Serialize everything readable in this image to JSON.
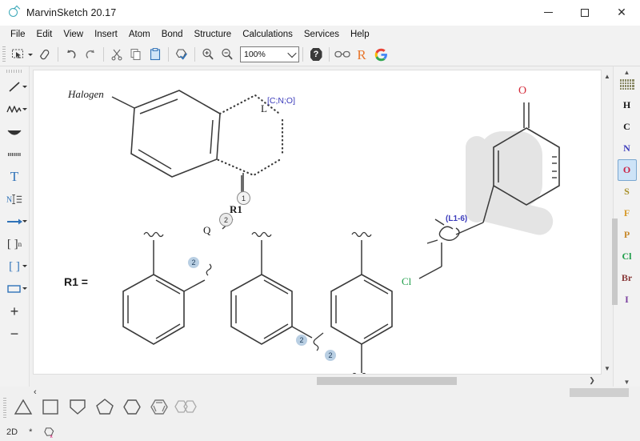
{
  "window": {
    "title": "MarvinSketch 20.17",
    "app_icon": "flask-icon",
    "minimize_label": "Minimize",
    "maximize_label": "Maximize",
    "close_label": "Close"
  },
  "menu": {
    "items": [
      {
        "label": "File"
      },
      {
        "label": "Edit"
      },
      {
        "label": "View"
      },
      {
        "label": "Insert"
      },
      {
        "label": "Atom"
      },
      {
        "label": "Bond"
      },
      {
        "label": "Structure"
      },
      {
        "label": "Calculations"
      },
      {
        "label": "Services"
      },
      {
        "label": "Help"
      }
    ]
  },
  "toolbar": {
    "buttons": [
      {
        "name": "rectangle-select-icon",
        "tooltip": "Selection"
      },
      {
        "name": "eraser-icon",
        "tooltip": "Eraser"
      },
      {
        "name": "undo-icon",
        "tooltip": "Undo"
      },
      {
        "name": "redo-icon",
        "tooltip": "Redo"
      },
      {
        "name": "cut-icon",
        "tooltip": "Cut"
      },
      {
        "name": "copy-icon",
        "tooltip": "Copy"
      },
      {
        "name": "paste-icon",
        "tooltip": "Paste"
      },
      {
        "name": "structure-checker-icon",
        "tooltip": "Structure Checker"
      },
      {
        "name": "zoom-in-icon",
        "tooltip": "Zoom In"
      },
      {
        "name": "zoom-out-icon",
        "tooltip": "Zoom Out"
      },
      {
        "name": "help-icon",
        "tooltip": "Help"
      },
      {
        "name": "glasses-icon",
        "tooltip": "View"
      },
      {
        "name": "reaxys-icon",
        "tooltip": "Reaxys"
      },
      {
        "name": "google-icon",
        "tooltip": "Google"
      }
    ],
    "zoom": {
      "value": "100%",
      "label": "Zoom level"
    },
    "reaxys_letter": "R",
    "google_letter": "G"
  },
  "left_tools": {
    "items": [
      {
        "name": "single-bond-tool",
        "label": "Single bond",
        "has_dropdown": true
      },
      {
        "name": "chain-tool",
        "label": "Chain",
        "has_dropdown": true
      },
      {
        "name": "arc-tool",
        "label": "Arc",
        "has_dropdown": false
      },
      {
        "name": "dotted-bond-tool",
        "label": "Dotted bond",
        "has_dropdown": false
      },
      {
        "name": "text-tool",
        "label": "Text",
        "has_dropdown": false,
        "glyph": "T"
      },
      {
        "name": "atom-label-tool",
        "label": "Atom label",
        "has_dropdown": false,
        "glyph": "N"
      },
      {
        "name": "reaction-arrow-tool",
        "label": "Reaction arrow",
        "has_dropdown": true
      },
      {
        "name": "repeating-unit-tool",
        "label": "Repeating unit",
        "has_dropdown": false,
        "glyph": "[ ]n"
      },
      {
        "name": "bracket-tool",
        "label": "Bracket",
        "has_dropdown": true,
        "glyph": "[ ]"
      },
      {
        "name": "rectangle-tool",
        "label": "Rectangle",
        "has_dropdown": true
      },
      {
        "name": "charge-plus-tool",
        "label": "Increase charge",
        "has_dropdown": false,
        "glyph": "+"
      },
      {
        "name": "charge-minus-tool",
        "label": "Decrease charge",
        "has_dropdown": false,
        "glyph": "−"
      }
    ]
  },
  "right_elements": {
    "periodic_table_label": "Periodic table",
    "scroll_up_label": "Scroll up",
    "scroll_down_label": "Scroll down",
    "selected": "O",
    "items": [
      {
        "symbol": "H",
        "color": "#1a1a1a"
      },
      {
        "symbol": "C",
        "color": "#1a1a1a"
      },
      {
        "symbol": "N",
        "color": "#3b3bbb"
      },
      {
        "symbol": "O",
        "color": "#cc2244"
      },
      {
        "symbol": "S",
        "color": "#a89028"
      },
      {
        "symbol": "F",
        "color": "#d79a2b"
      },
      {
        "symbol": "P",
        "color": "#c88a2c"
      },
      {
        "symbol": "Cl",
        "color": "#1f9e4a"
      },
      {
        "symbol": "Br",
        "color": "#8a3a3a"
      },
      {
        "symbol": "I",
        "color": "#7a3f9e"
      }
    ]
  },
  "bottom_templates": {
    "prev_label": "‹",
    "shapes": [
      {
        "name": "triangle-template",
        "label": "Cyclopropane"
      },
      {
        "name": "square-template",
        "label": "Cyclobutane"
      },
      {
        "name": "home-template",
        "label": "Cyclopentadiene"
      },
      {
        "name": "pentagon-template",
        "label": "Cyclopentane"
      },
      {
        "name": "hexagon-template",
        "label": "Cyclohexane"
      },
      {
        "name": "benzene-template",
        "label": "Benzene"
      },
      {
        "name": "naphthalene-template",
        "label": "Naphthalene"
      }
    ]
  },
  "statusbar": {
    "dimension": "2D",
    "chirality_flag": "*",
    "checker_status": "no-errors"
  },
  "canvas": {
    "structure_left": {
      "halogen_label": "Halogen",
      "linker_label": "L",
      "linker_query": "[C;N;O]",
      "map_1": "1",
      "map_2": "2",
      "r1_label": "R1",
      "q_label": "Q"
    },
    "r_group_definition": {
      "title": "R1 =",
      "members": [
        {
          "name": "ortho-phenyl",
          "map": "2"
        },
        {
          "name": "meta-phenyl",
          "map": "2"
        },
        {
          "name": "para-phenyl",
          "map": "2"
        }
      ]
    },
    "structure_right": {
      "oxygen_label": "O",
      "chlorine_label": "Cl",
      "link_node_label": "(L1-6)"
    },
    "colors": {
      "oxygen": "#d42b3a",
      "chlorine": "#1f9e4a",
      "blue_label": "#3b3bbb",
      "highlight": "#d8d8d8",
      "bond": "#3a3a3a",
      "map_circle": "#9bb8d4"
    }
  }
}
